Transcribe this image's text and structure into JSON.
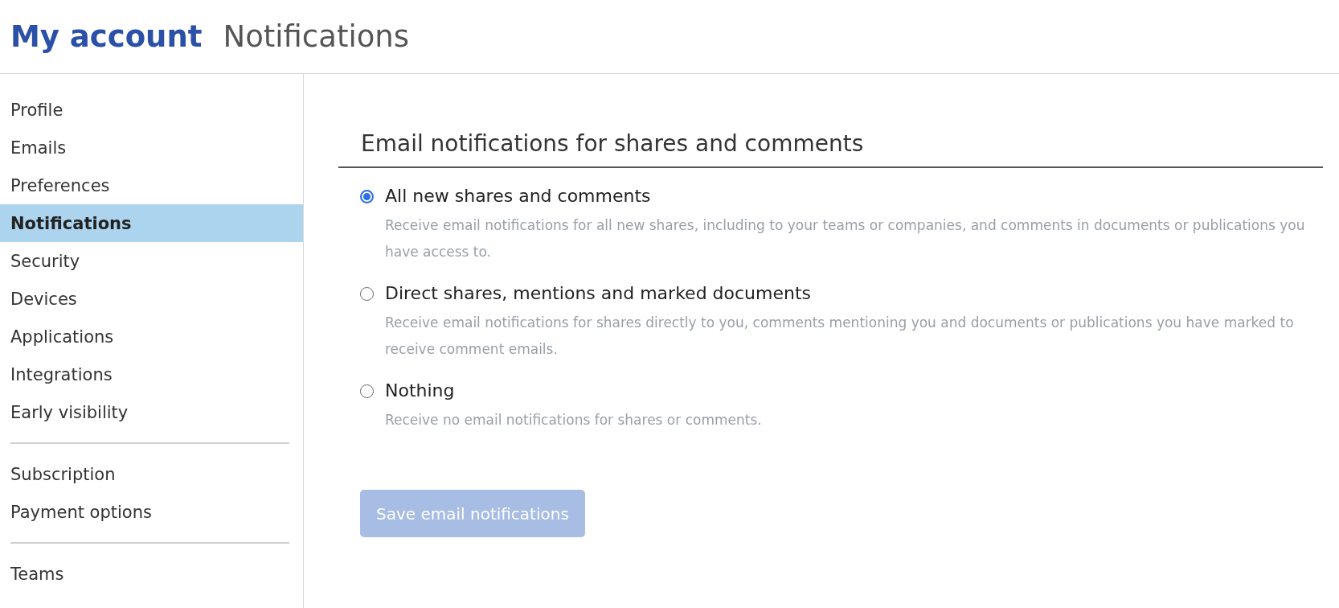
{
  "header": {
    "title": "My account",
    "subtitle": "Notifications"
  },
  "sidebar": {
    "groups": [
      {
        "items": [
          {
            "label": "Profile",
            "selected": false
          },
          {
            "label": "Emails",
            "selected": false
          },
          {
            "label": "Preferences",
            "selected": false
          },
          {
            "label": "Notifications",
            "selected": true
          },
          {
            "label": "Security",
            "selected": false
          },
          {
            "label": "Devices",
            "selected": false
          },
          {
            "label": "Applications",
            "selected": false
          },
          {
            "label": "Integrations",
            "selected": false
          },
          {
            "label": "Early visibility",
            "selected": false
          }
        ]
      },
      {
        "items": [
          {
            "label": "Subscription",
            "selected": false
          },
          {
            "label": "Payment options",
            "selected": false
          }
        ]
      },
      {
        "items": [
          {
            "label": "Teams",
            "selected": false
          }
        ]
      }
    ]
  },
  "section": {
    "heading": "Email notifications for shares and comments",
    "options": [
      {
        "label": "All new shares and comments",
        "description": "Receive email notifications for all new shares, including to your teams or companies, and comments in documents or publications you have access to.",
        "selected": true
      },
      {
        "label": "Direct shares, mentions and marked documents",
        "description": "Receive email notifications for shares directly to you, comments mentioning you and documents or publications you have marked to receive comment emails.",
        "selected": false
      },
      {
        "label": "Nothing",
        "description": "Receive no email notifications for shares or comments.",
        "selected": false
      }
    ],
    "save_button": {
      "label": "Save email notifications",
      "disabled": true
    }
  }
}
